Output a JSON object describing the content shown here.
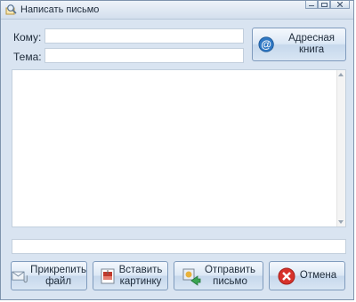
{
  "window": {
    "title": "Написать письмо",
    "icon": "search-envelope-icon"
  },
  "form": {
    "to_label": "Кому:",
    "to_value": "",
    "subject_label": "Тема:",
    "subject_value": ""
  },
  "address_book_button": {
    "label": "Адресная книга",
    "icon": "at-sign-icon"
  },
  "message_body": {
    "value": ""
  },
  "status": {
    "text": ""
  },
  "actions": {
    "attach": {
      "line1": "Прикрепить",
      "line2": "файл",
      "icon": "attach-envelope-icon"
    },
    "insert_image": {
      "line1": "Вставить",
      "line2": "картинку",
      "icon": "picture-icon"
    },
    "send": {
      "line1": "Отправить",
      "line2": "письмо",
      "icon": "send-mail-icon"
    },
    "cancel": {
      "label": "Отмена",
      "icon": "cancel-icon"
    }
  },
  "colors": {
    "window_bg": "#d9e4f1",
    "cancel_red": "#d7322b",
    "at_blue": "#2f78c4"
  }
}
